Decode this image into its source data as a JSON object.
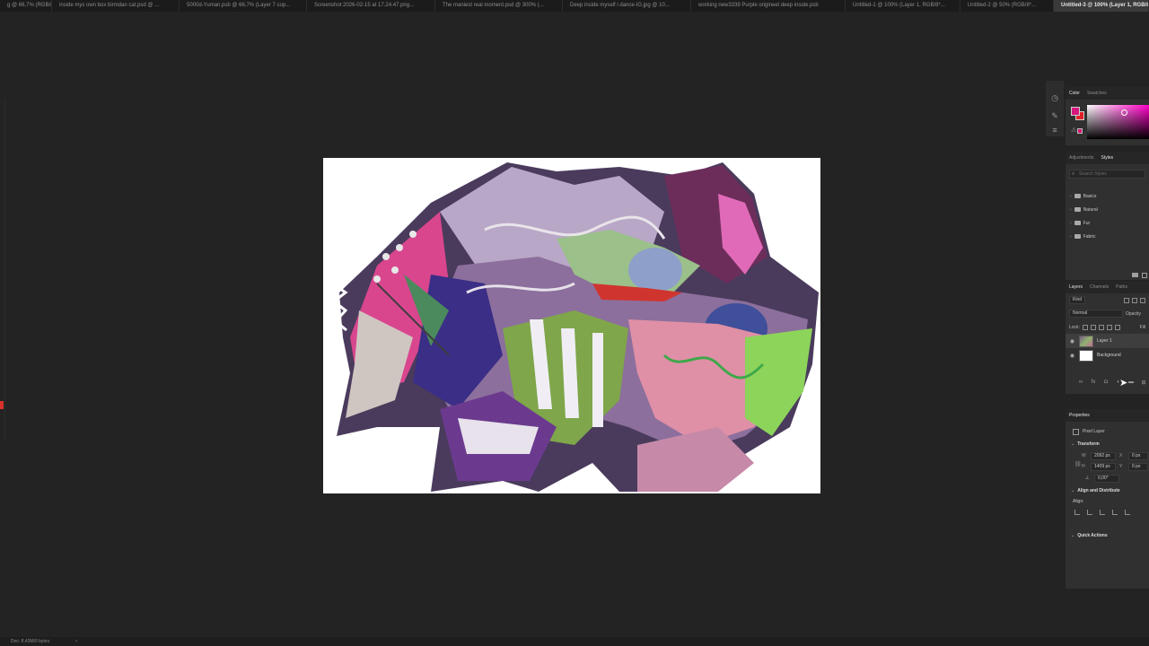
{
  "doc_tabs": [
    "g @ 66,7% (RGB/8...",
    "inside mys own box birmdan cat.psd @ ...",
    "5000d-Yuman.psb @ 66,7% (Layer 7 cop...",
    "Screenshot 2026-02-15 at 17.24.47.png...",
    "The maniest real moment.psd @ 300% (...",
    "Deep inside myself i dance-IG.jpg @ 10...",
    "working new3339 Purple origineel deep inside.psb",
    "Untitled-1 @ 100% (Layer 1, RGB/8*...",
    "Untitled-2 @ 50% (RGB/8*...",
    "Untitled-3 @ 100% (Layer 1, RGB/8"
  ],
  "active_tab_index": 9,
  "color_panel": {
    "tabs": [
      "Color",
      "Swatches"
    ],
    "foreground": "#d6187e",
    "background": "#e0202a"
  },
  "styles_panel": {
    "tabs": [
      "Adjustments",
      "Styles"
    ],
    "search_placeholder": "Search Styles",
    "folders": [
      "Basics",
      "Natural",
      "Fur",
      "Fabric"
    ]
  },
  "layers_panel": {
    "tabs": [
      "Layers",
      "Channels",
      "Paths"
    ],
    "filter_kind": "Kind",
    "blend_mode": "Normal",
    "opacity_label": "Opacity",
    "lock_label": "Lock:",
    "fill_label": "Fill",
    "layers": [
      {
        "name": "Layer 1",
        "selected": true
      },
      {
        "name": "Background",
        "selected": false
      }
    ]
  },
  "properties_panel": {
    "title": "Properties",
    "layer_type": "Pixel Layer",
    "transform_title": "Transform",
    "w_label": "W",
    "w_value": "2092 px",
    "h_label": "H",
    "h_value": "1409 px",
    "x_label": "X",
    "x_value": "0 px",
    "y_label": "Y",
    "y_value": "0 px",
    "angle_value": "0,00°",
    "align_title": "Align and Distribute",
    "align_label": "Align:",
    "quick_actions_title": "Quick Actions"
  },
  "status_bar": {
    "doc_info": "Doc: 8,43M/0 bytes"
  }
}
